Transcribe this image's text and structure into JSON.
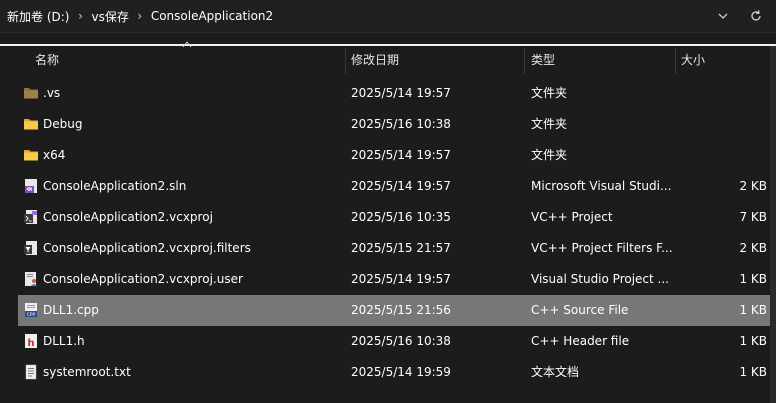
{
  "breadcrumb": {
    "drive": "新加卷 (D:)",
    "folder1": "vs保存",
    "folder2": "ConsoleApplication2"
  },
  "columns": {
    "name": "名称",
    "modified": "修改日期",
    "type": "类型",
    "size": "大小"
  },
  "files": [
    {
      "name": ".vs",
      "modified": "2025/5/14 19:57",
      "type": "文件夹",
      "size": "",
      "icon": "folder-dim-icon"
    },
    {
      "name": "Debug",
      "modified": "2025/5/16 10:38",
      "type": "文件夹",
      "size": "",
      "icon": "folder-icon"
    },
    {
      "name": "x64",
      "modified": "2025/5/14 19:57",
      "type": "文件夹",
      "size": "",
      "icon": "folder-icon"
    },
    {
      "name": "ConsoleApplication2.sln",
      "modified": "2025/5/14 19:57",
      "type": "Microsoft Visual Studi...",
      "size": "2 KB",
      "icon": "sln-file-icon"
    },
    {
      "name": "ConsoleApplication2.vcxproj",
      "modified": "2025/5/16 10:35",
      "type": "VC++ Project",
      "size": "7 KB",
      "icon": "vcxproj-file-icon"
    },
    {
      "name": "ConsoleApplication2.vcxproj.filters",
      "modified": "2025/5/15 21:57",
      "type": "VC++ Project Filters F...",
      "size": "2 KB",
      "icon": "filters-file-icon"
    },
    {
      "name": "ConsoleApplication2.vcxproj.user",
      "modified": "2025/5/14 19:57",
      "type": "Visual Studio Project ...",
      "size": "1 KB",
      "icon": "user-file-icon"
    },
    {
      "name": "DLL1.cpp",
      "modified": "2025/5/15 21:56",
      "type": "C++ Source File",
      "size": "1 KB",
      "icon": "cpp-file-icon",
      "selected": true
    },
    {
      "name": "DLL1.h",
      "modified": "2025/5/16 10:38",
      "type": "C++ Header file",
      "size": "1 KB",
      "icon": "h-file-icon"
    },
    {
      "name": "systemroot.txt",
      "modified": "2025/5/14 19:59",
      "type": "文本文档",
      "size": "1 KB",
      "icon": "txt-file-icon"
    }
  ],
  "colors": {
    "background": "#1c1c1c",
    "selected_row": "#777777",
    "folder": "#f8c94a"
  }
}
